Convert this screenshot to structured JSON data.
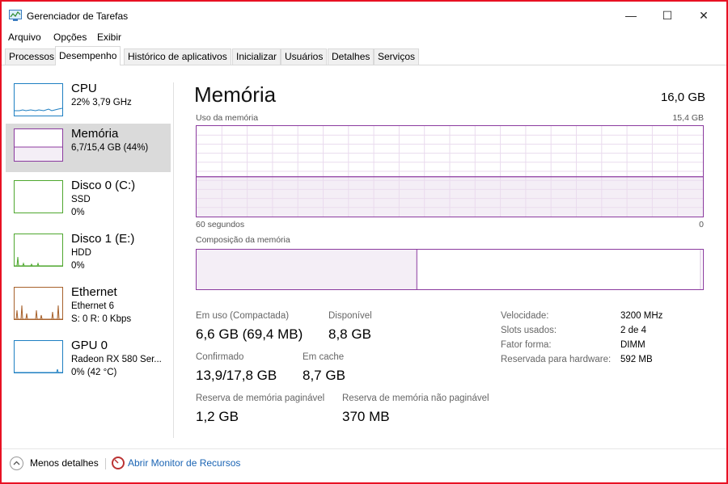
{
  "window": {
    "title": "Gerenciador de Tarefas",
    "minimize": "—",
    "maximize": "☐",
    "close": "✕"
  },
  "menu": [
    "Arquivo",
    "Opções",
    "Exibir"
  ],
  "tabs": [
    {
      "label": "Processos",
      "active": false
    },
    {
      "label": "Desempenho",
      "active": true
    },
    {
      "label": "Histórico de aplicativos",
      "active": false
    },
    {
      "label": "Inicializar",
      "active": false
    },
    {
      "label": "Usuários",
      "active": false
    },
    {
      "label": "Detalhes",
      "active": false
    },
    {
      "label": "Serviços",
      "active": false
    }
  ],
  "resources": [
    {
      "name": "CPU",
      "line1": "22% 3,79 GHz",
      "line2": "",
      "color": "#1e7fc2",
      "selected": false
    },
    {
      "name": "Memória",
      "line1": "6,7/15,4 GB (44%)",
      "line2": "",
      "color": "#8b3a9f",
      "selected": true
    },
    {
      "name": "Disco 0 (C:)",
      "line1": "SSD",
      "line2": "0%",
      "color": "#4ea72e",
      "selected": false
    },
    {
      "name": "Disco 1 (E:)",
      "line1": "HDD",
      "line2": "0%",
      "color": "#4ea72e",
      "selected": false
    },
    {
      "name": "Ethernet",
      "line1": "Ethernet 6",
      "line2": "S: 0 R: 0 Kbps",
      "color": "#a7612b",
      "selected": false
    },
    {
      "name": "GPU 0",
      "line1": "Radeon RX 580 Ser...",
      "line2": "0% (42 °C)",
      "color": "#1e7fc2",
      "selected": false
    }
  ],
  "memory": {
    "title": "Memória",
    "total": "16,0 GB",
    "usage_label": "Uso da memória",
    "usage_max": "15,4 GB",
    "time_left": "60 segundos",
    "time_right": "0",
    "usage_fraction": 0.44,
    "composition_label": "Composição da memória",
    "composition_in_use_fraction": 0.435,
    "stats": {
      "in_use_label": "Em uso (Compactada)",
      "in_use_value": "6,6 GB (69,4 MB)",
      "available_label": "Disponível",
      "available_value": "8,8 GB",
      "committed_label": "Confirmado",
      "committed_value": "13,9/17,8 GB",
      "cached_label": "Em cache",
      "cached_value": "8,7 GB",
      "paged_label": "Reserva de memória paginável",
      "paged_value": "1,2 GB",
      "nonpaged_label": "Reserva de memória não paginável",
      "nonpaged_value": "370 MB"
    },
    "details": {
      "speed_label": "Velocidade:",
      "speed_value": "3200 MHz",
      "slots_label": "Slots usados:",
      "slots_value": "2 de 4",
      "form_label": "Fator forma:",
      "form_value": "DIMM",
      "reserved_label": "Reservada para hardware:",
      "reserved_value": "592 MB"
    }
  },
  "footer": {
    "fewer_details": "Menos detalhes",
    "open_monitor": "Abrir Monitor de Recursos"
  }
}
